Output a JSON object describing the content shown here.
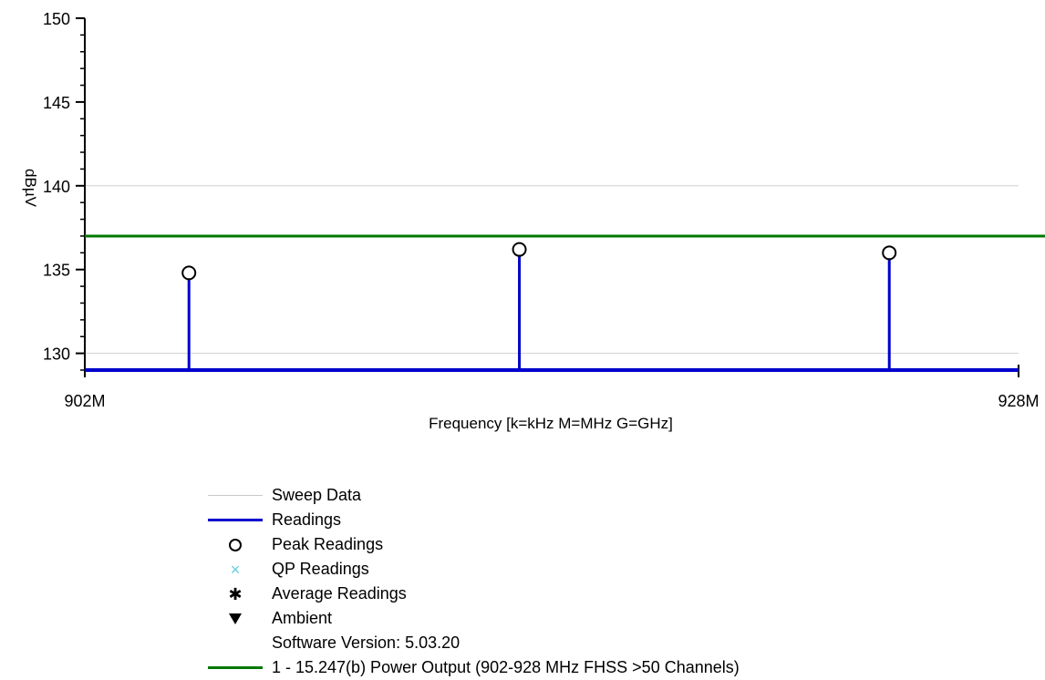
{
  "chart_data": {
    "type": "line",
    "title": "",
    "xlabel": "Frequency [k=kHz M=MHz G=GHz]",
    "ylabel": "dBµV",
    "xlim": [
      902,
      928
    ],
    "ylim": [
      129,
      150
    ],
    "x_tick_labels": [
      {
        "value": 902,
        "label": "902M"
      },
      {
        "value": 928,
        "label": "928M"
      }
    ],
    "y_major_ticks": [
      130,
      135,
      140,
      145,
      150
    ],
    "y_tick_labels": [
      "130",
      "135",
      "140",
      "145",
      "150"
    ],
    "gridlines_y": [
      130,
      140
    ],
    "series": [
      {
        "name": "Readings",
        "type": "stem",
        "color": "#0000cc",
        "points": [
          {
            "x": 904.9,
            "y": 134.8
          },
          {
            "x": 914.1,
            "y": 136.2
          },
          {
            "x": 924.4,
            "y": 136.0
          }
        ]
      },
      {
        "name": "Peak Readings",
        "type": "marker",
        "marker": "circle",
        "color": "#000000",
        "points": [
          {
            "x": 904.9,
            "y": 134.8
          },
          {
            "x": 914.1,
            "y": 136.2
          },
          {
            "x": 924.4,
            "y": 136.0
          }
        ]
      },
      {
        "name": "1 - 15.247(b) Power Output (902-928 MHz FHSS >50 Channels)",
        "type": "limit",
        "color": "#007700",
        "y": 137
      }
    ],
    "legend_position": "bottom"
  },
  "legend": {
    "items": [
      {
        "label": "Sweep Data",
        "symbol": "line",
        "color": "#c8c8c8"
      },
      {
        "label": "Readings",
        "symbol": "line",
        "color": "#0000cc"
      },
      {
        "label": "Peak Readings",
        "symbol": "circle",
        "color": "#000000"
      },
      {
        "label": "QP Readings",
        "symbol": "×",
        "color": "#66ccdd"
      },
      {
        "label": "Average Readings",
        "symbol": "✱",
        "color": "#000000"
      },
      {
        "label": "Ambient",
        "symbol": "triangle-down",
        "color": "#000000"
      },
      {
        "label": "Software Version: 5.03.20",
        "symbol": "none",
        "color": ""
      },
      {
        "label": "1 - 15.247(b) Power Output (902-928 MHz FHSS >50 Channels)",
        "symbol": "line",
        "color": "#007700"
      }
    ]
  }
}
